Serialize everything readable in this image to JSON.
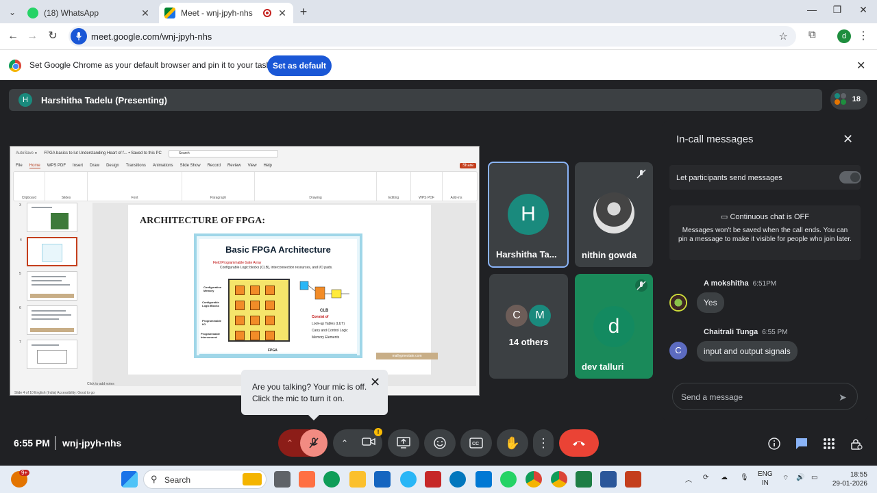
{
  "browser": {
    "tabs": [
      {
        "title": "(18) WhatsApp",
        "active": false
      },
      {
        "title": "Meet - wnj-jpyh-nhs",
        "active": true
      }
    ],
    "url": "meet.google.com/wnj-jpyh-nhs",
    "profile_initial": "d",
    "infobar": {
      "text": "Set Google Chrome as your default browser and pin it to your taskbar",
      "button": "Set as default"
    }
  },
  "meet": {
    "presenter_initial": "H",
    "presenter_label": "Harshitha Tadelu (Presenting)",
    "participant_count": "18",
    "slide": {
      "window_title": "FPGA basics to lut Understanding Heart of f... • Saved to this PC",
      "search_placeholder": "Search",
      "menu": [
        "File",
        "Home",
        "WPS PDF",
        "Insert",
        "Draw",
        "Design",
        "Transitions",
        "Animations",
        "Slide Show",
        "Record",
        "Review",
        "View",
        "Help"
      ],
      "share_label": "Share",
      "ribbon_groups": [
        "Clipboard",
        "Slides",
        "Font",
        "Paragraph",
        "Drawing",
        "Editing",
        "WPS PDF",
        "Add-ins"
      ],
      "thumb_numbers": [
        "3",
        "4",
        "5",
        "6",
        "7"
      ],
      "heading": "ARCHITECTURE OF FPGA:",
      "inner_title": "Basic FPGA Architecture",
      "inner_sub": "Field Programmable Gate Array",
      "inner_desc": "Configurable Logic blocks (CLB), interconnection resources, and I/O pads.",
      "side_labels": [
        "Configuration Memory",
        "Configurable Logic Blocks",
        "Programmable I/O",
        "Programmable Interconnect"
      ],
      "clb_title": "CLB",
      "clb_consist": "Consist of",
      "clb_items": [
        "Look-up Tables (LUT)",
        "Carry and Control Logic",
        "Memory Elements"
      ],
      "fpga_caption": "FPGA",
      "tag": "mallygmestate.com",
      "notes": "Click to add notes",
      "status": "Slide 4 of 10    English (India)    Accessibility: Good to go"
    },
    "tiles": [
      {
        "name": "Harshitha Ta...",
        "initial": "H"
      },
      {
        "name": "nithin gowda"
      },
      {
        "name": "14 others",
        "initials": [
          "C",
          "M"
        ]
      },
      {
        "name": "dev talluri",
        "initial": "d"
      }
    ]
  },
  "chat": {
    "title": "In-call messages",
    "permission": "Let participants send messages",
    "continuous_title": "Continuous chat is OFF",
    "continuous_body": "Messages won't be saved when the call ends. You can pin a message to make it visible for people who join later.",
    "messages": [
      {
        "author": "A mokshitha",
        "time": "6:51PM",
        "text": "Yes"
      },
      {
        "author": "Chaitrali Tunga",
        "time": "6:55 PM",
        "text": "input and output signals",
        "initial": "C"
      }
    ],
    "input_placeholder": "Send a message"
  },
  "tooltip": {
    "text": "Are you talking? Your mic is off. Click the mic to turn it on."
  },
  "controls": {
    "time": "6:55 PM",
    "meeting_code": "wnj-jpyh-nhs"
  },
  "taskbar": {
    "search": "Search",
    "lang": "ENG",
    "region": "IN",
    "time": "18:55",
    "date": "29-01-2026",
    "badge": "9+"
  },
  "colors": {
    "meet_bg": "#202124",
    "tile_bg": "#3c4043",
    "accent_green": "#1a8a7d",
    "end_call": "#ea4335",
    "chrome_blue": "#1a57d6"
  }
}
